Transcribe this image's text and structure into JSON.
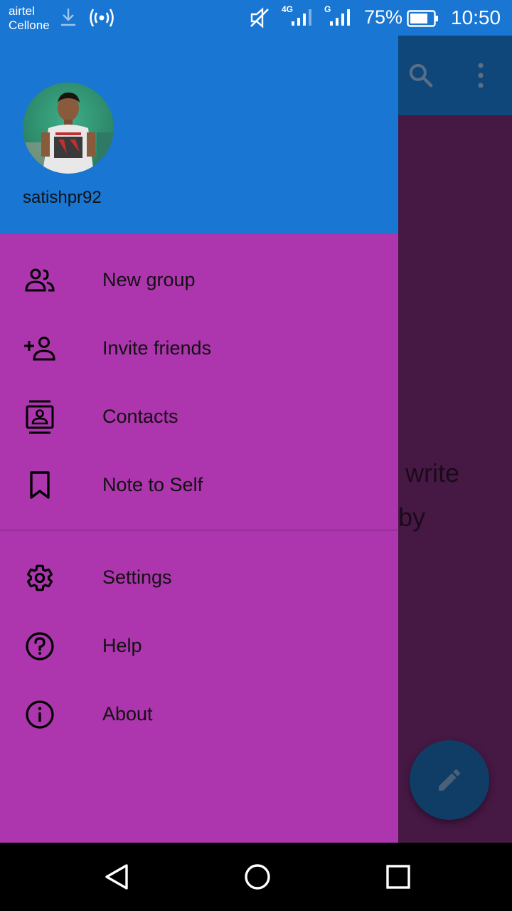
{
  "status_bar": {
    "carrier_line1": "airtel",
    "carrier_line2": "Cellone",
    "network_4g": "4G",
    "network_g": "G",
    "battery": "75%",
    "time": "10:50"
  },
  "drawer": {
    "username": "satishpr92",
    "items": [
      {
        "label": "New group",
        "icon": "group-icon"
      },
      {
        "label": "Invite friends",
        "icon": "add-person-icon"
      },
      {
        "label": "Contacts",
        "icon": "contacts-icon"
      },
      {
        "label": "Note to Self",
        "icon": "bookmark-icon"
      },
      {
        "label": "Settings",
        "icon": "gear-icon"
      },
      {
        "label": "Help",
        "icon": "help-icon"
      },
      {
        "label": "About",
        "icon": "info-icon"
      }
    ]
  },
  "background": {
    "text_line1": "o write",
    "text_line2": "by"
  },
  "colors": {
    "header": "#1976d2",
    "drawer": "#ad35ad",
    "scrim_body": "#461844",
    "scrim_toolbar": "#0f477a"
  }
}
